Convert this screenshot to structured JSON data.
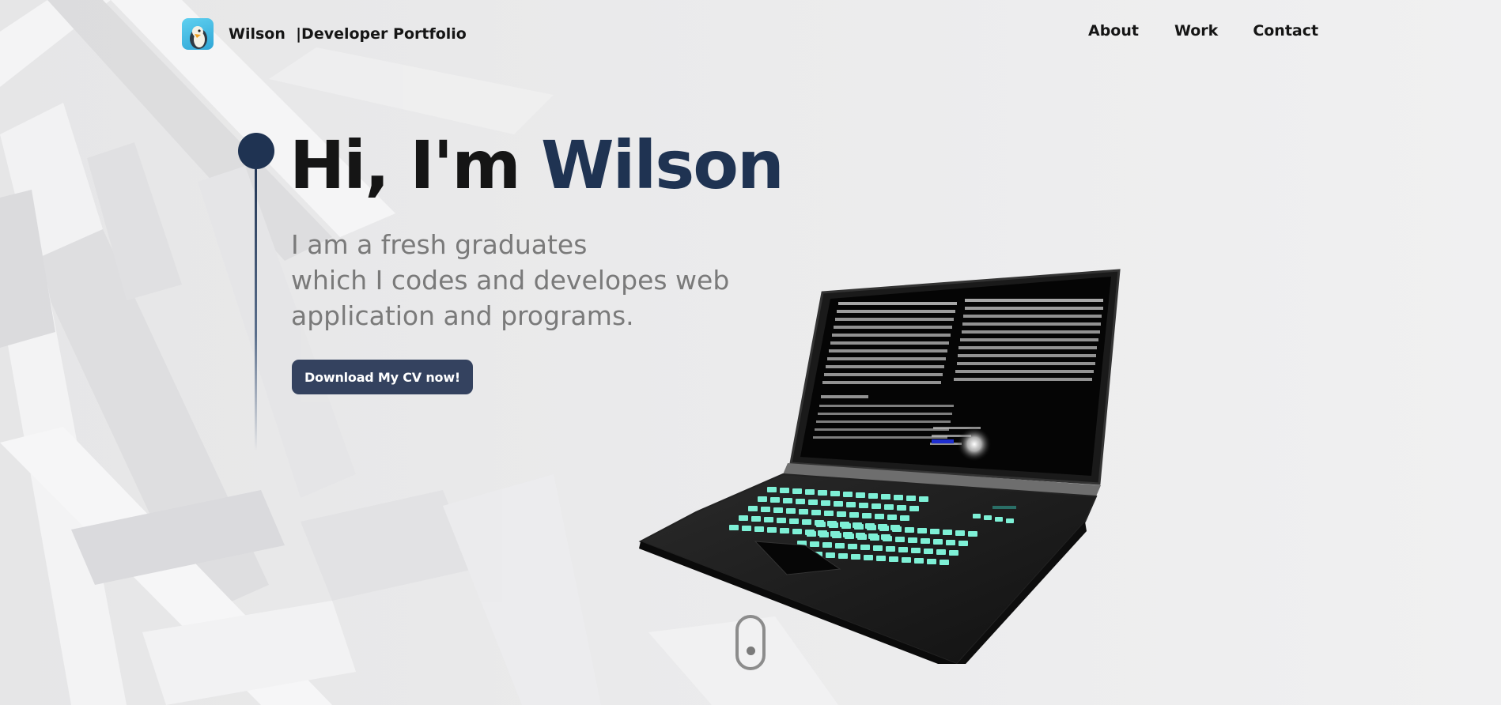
{
  "header": {
    "brand_name": "Wilson",
    "brand_suffix": "|Developer Portfolio",
    "logo_icon": "penguin-icon",
    "nav": {
      "about": "About",
      "work": "Work",
      "contact": "Contact"
    }
  },
  "hero": {
    "greeting": "Hi, I'm",
    "name": "Wilson",
    "description_lines": [
      "I am a fresh graduates",
      "which I codes and developes web",
      "application and programs."
    ],
    "cta_label": "Download My CV now!"
  },
  "colors": {
    "accent": "#1f3352",
    "button": "#34425f",
    "text_dark": "#151515",
    "text_muted": "#7a7a7a",
    "background": "#ededee",
    "keys": "#7ef0d6"
  }
}
